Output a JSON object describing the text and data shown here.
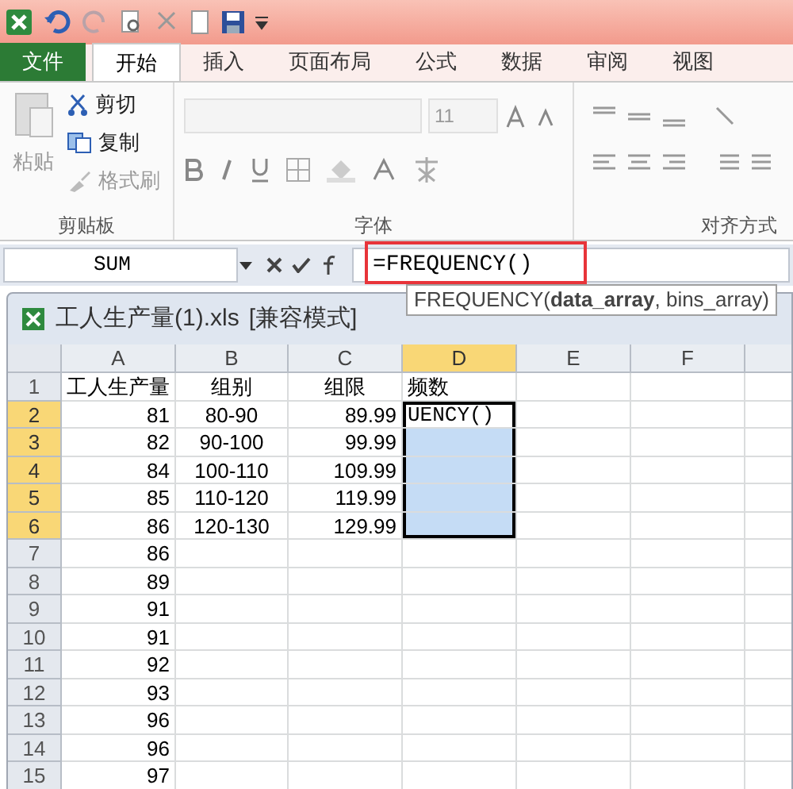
{
  "tabs": [
    {
      "label": "文件",
      "kind": "file",
      "selected": false
    },
    {
      "label": "开始",
      "kind": "tab",
      "selected": true
    },
    {
      "label": "插入",
      "kind": "tab",
      "selected": false
    },
    {
      "label": "页面布局",
      "kind": "tab",
      "selected": false
    },
    {
      "label": "公式",
      "kind": "tab",
      "selected": false
    },
    {
      "label": "数据",
      "kind": "tab",
      "selected": false
    },
    {
      "label": "审阅",
      "kind": "tab",
      "selected": false
    },
    {
      "label": "视图",
      "kind": "tab",
      "selected": false
    }
  ],
  "clipboard": {
    "paste": {
      "label": "粘贴",
      "disabled": true
    },
    "buttons": [
      {
        "label": "剪切",
        "disabled": false
      },
      {
        "label": "复制",
        "disabled": false
      },
      {
        "label": "格式刷",
        "disabled": true
      }
    ],
    "label": "剪贴板"
  },
  "font": {
    "size": "11",
    "label": "字体"
  },
  "alignment": {
    "label": "对齐方式"
  },
  "formula_bar": {
    "name_box": "SUM",
    "formula": "=FREQUENCY()",
    "tooltip": "FREQUENCY(**data_array**, bins_array)"
  },
  "workbook": {
    "title": "工人生产量(1).xls",
    "mode": "[兼容模式]"
  },
  "columns": [
    {
      "label": "A",
      "selected": false
    },
    {
      "label": "B",
      "selected": false
    },
    {
      "label": "C",
      "selected": false
    },
    {
      "label": "D",
      "selected": true
    },
    {
      "label": "E",
      "selected": false
    },
    {
      "label": "F",
      "selected": false
    }
  ],
  "rows": [
    {
      "number": "1",
      "selected": false,
      "cells": {
        "A": "工人生产量",
        "B": "组别",
        "C": "组限",
        "D": "频数"
      }
    },
    {
      "number": "2",
      "selected": true,
      "cells": {
        "A": "81",
        "B": "80-90",
        "C": "89.99",
        "D": "UENCY()"
      }
    },
    {
      "number": "3",
      "selected": true,
      "cells": {
        "A": "82",
        "B": "90-100",
        "C": "99.99"
      }
    },
    {
      "number": "4",
      "selected": true,
      "cells": {
        "A": "84",
        "B": "100-110",
        "C": "109.99"
      }
    },
    {
      "number": "5",
      "selected": true,
      "cells": {
        "A": "85",
        "B": "110-120",
        "C": "119.99"
      }
    },
    {
      "number": "6",
      "selected": true,
      "cells": {
        "A": "86",
        "B": "120-130",
        "C": "129.99"
      }
    },
    {
      "number": "7",
      "selected": false,
      "cells": {
        "A": "86"
      }
    },
    {
      "number": "8",
      "selected": false,
      "cells": {
        "A": "89"
      }
    },
    {
      "number": "9",
      "selected": false,
      "cells": {
        "A": "91"
      }
    },
    {
      "number": "10",
      "selected": false,
      "cells": {
        "A": "91"
      }
    },
    {
      "number": "11",
      "selected": false,
      "cells": {
        "A": "92"
      }
    },
    {
      "number": "12",
      "selected": false,
      "cells": {
        "A": "93"
      }
    },
    {
      "number": "13",
      "selected": false,
      "cells": {
        "A": "96"
      }
    },
    {
      "number": "14",
      "selected": false,
      "cells": {
        "A": "96"
      }
    },
    {
      "number": "15",
      "selected": false,
      "cells": {
        "A": "97"
      }
    }
  ]
}
